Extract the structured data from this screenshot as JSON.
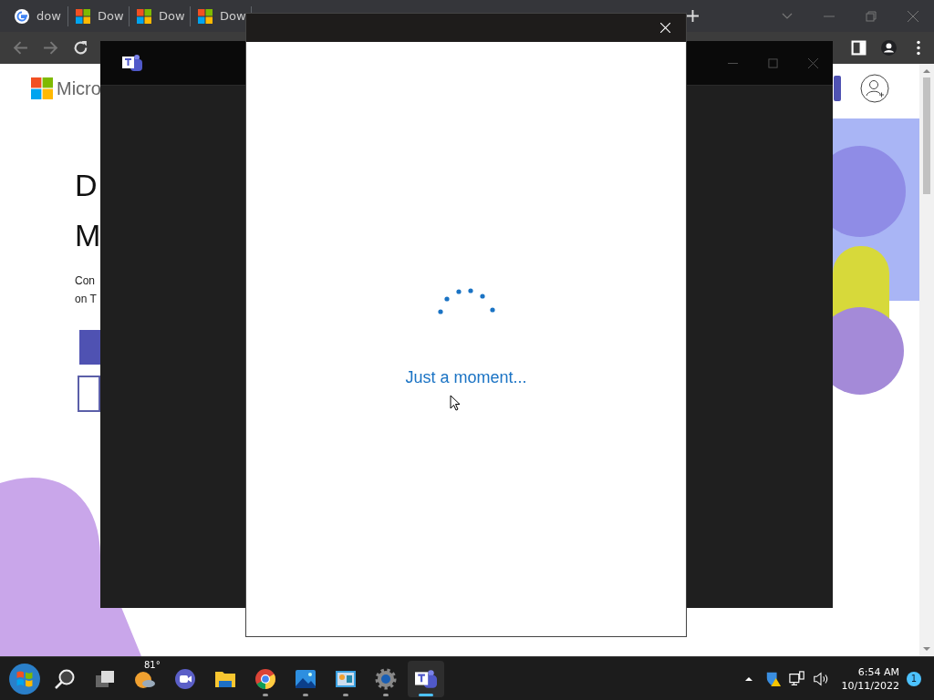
{
  "browser": {
    "tabs": [
      {
        "title": "dow",
        "kind": "google"
      },
      {
        "title": "Dow",
        "kind": "microsoft"
      },
      {
        "title": "Dow",
        "kind": "microsoft"
      },
      {
        "title": "Dow",
        "kind": "microsoft"
      }
    ],
    "page": {
      "brand": "Micro",
      "heading_lines": [
        "D",
        "M"
      ],
      "intro_lines": [
        "Con",
        "on T"
      ]
    }
  },
  "dialog": {
    "status": "Just a moment..."
  },
  "taskbar": {
    "apps": [
      {
        "kind": "start",
        "running": false,
        "active": false
      },
      {
        "kind": "search",
        "running": false,
        "active": false
      },
      {
        "kind": "taskview",
        "running": false,
        "active": false
      },
      {
        "kind": "weather",
        "label": "81°",
        "running": false,
        "active": false
      },
      {
        "kind": "meet",
        "running": false,
        "active": false
      },
      {
        "kind": "files",
        "running": false,
        "active": false
      },
      {
        "kind": "chrome",
        "running": true,
        "active": false
      },
      {
        "kind": "photos",
        "running": true,
        "active": false
      },
      {
        "kind": "dashboard",
        "running": true,
        "active": false
      },
      {
        "kind": "settings",
        "running": true,
        "active": false
      },
      {
        "kind": "teams",
        "running": true,
        "active": true
      }
    ],
    "tray": {
      "time": "6:54 AM",
      "date": "10/11/2022",
      "notifications": "1"
    }
  }
}
